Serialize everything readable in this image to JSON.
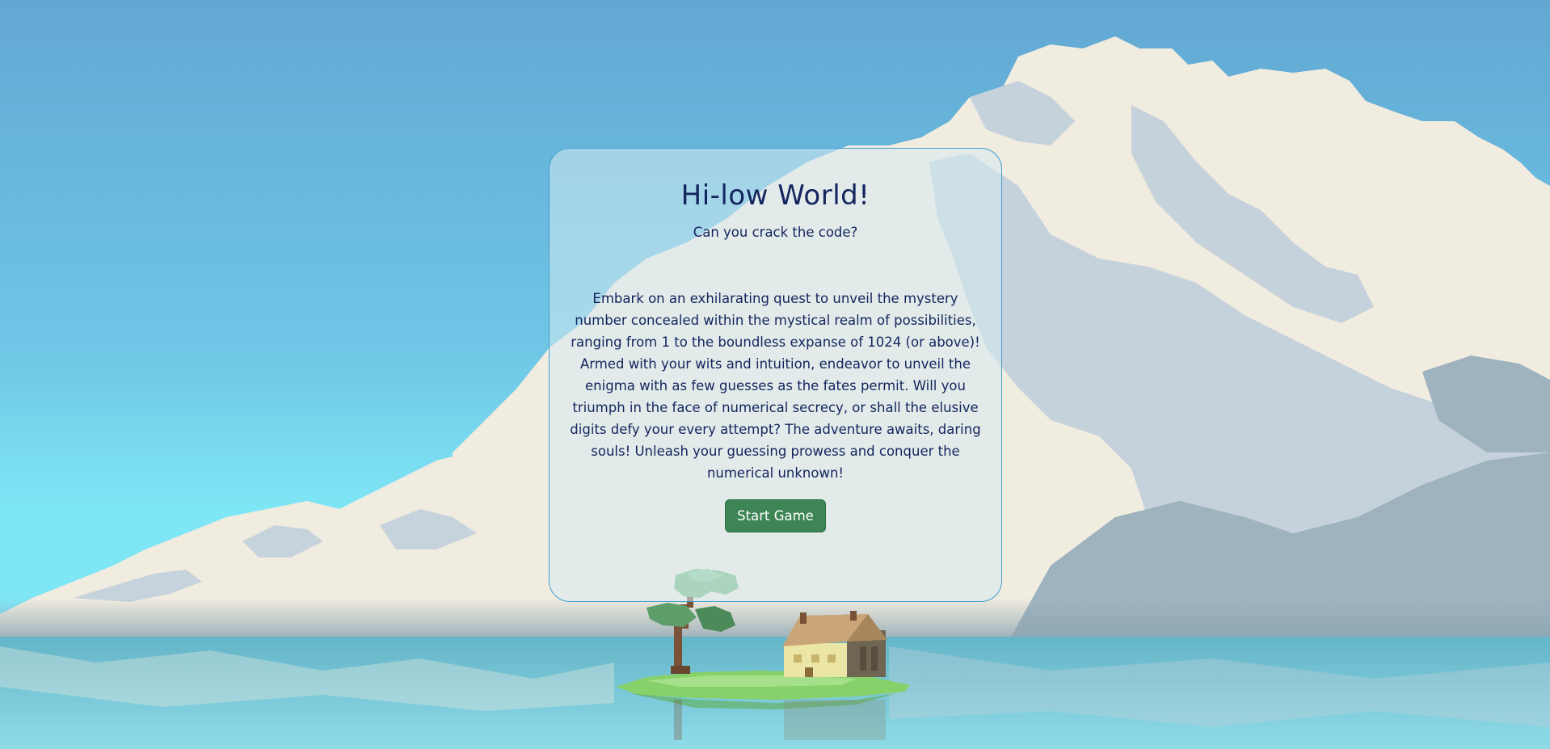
{
  "game": {
    "title": "Hi-low World!",
    "subtitle": "Can you crack the code?",
    "description": "Embark on an exhilarating quest to unveil the mystery number concealed within the mystical realm of possibilities, ranging from 1 to the boundless expanse of 1024 (or above)! Armed with your wits and intuition, endeavor to unveil the enigma with as few guesses as the fates permit. Will you triumph in the face of numerical secrecy, or shall the elusive digits defy your every attempt? The adventure awaits, daring souls! Unleash your guessing prowess and conquer the numerical unknown!",
    "start_button_label": "Start Game"
  },
  "colors": {
    "sky_top": "#63a9d4",
    "sky_bottom": "#7de3f4",
    "cloud_light": "#f1ece0",
    "cloud_shadow": "#c7d3dc",
    "water": "#72c6d8",
    "text": "#14245e",
    "button": "#3d8555",
    "card_border": "#3f9fd0"
  }
}
